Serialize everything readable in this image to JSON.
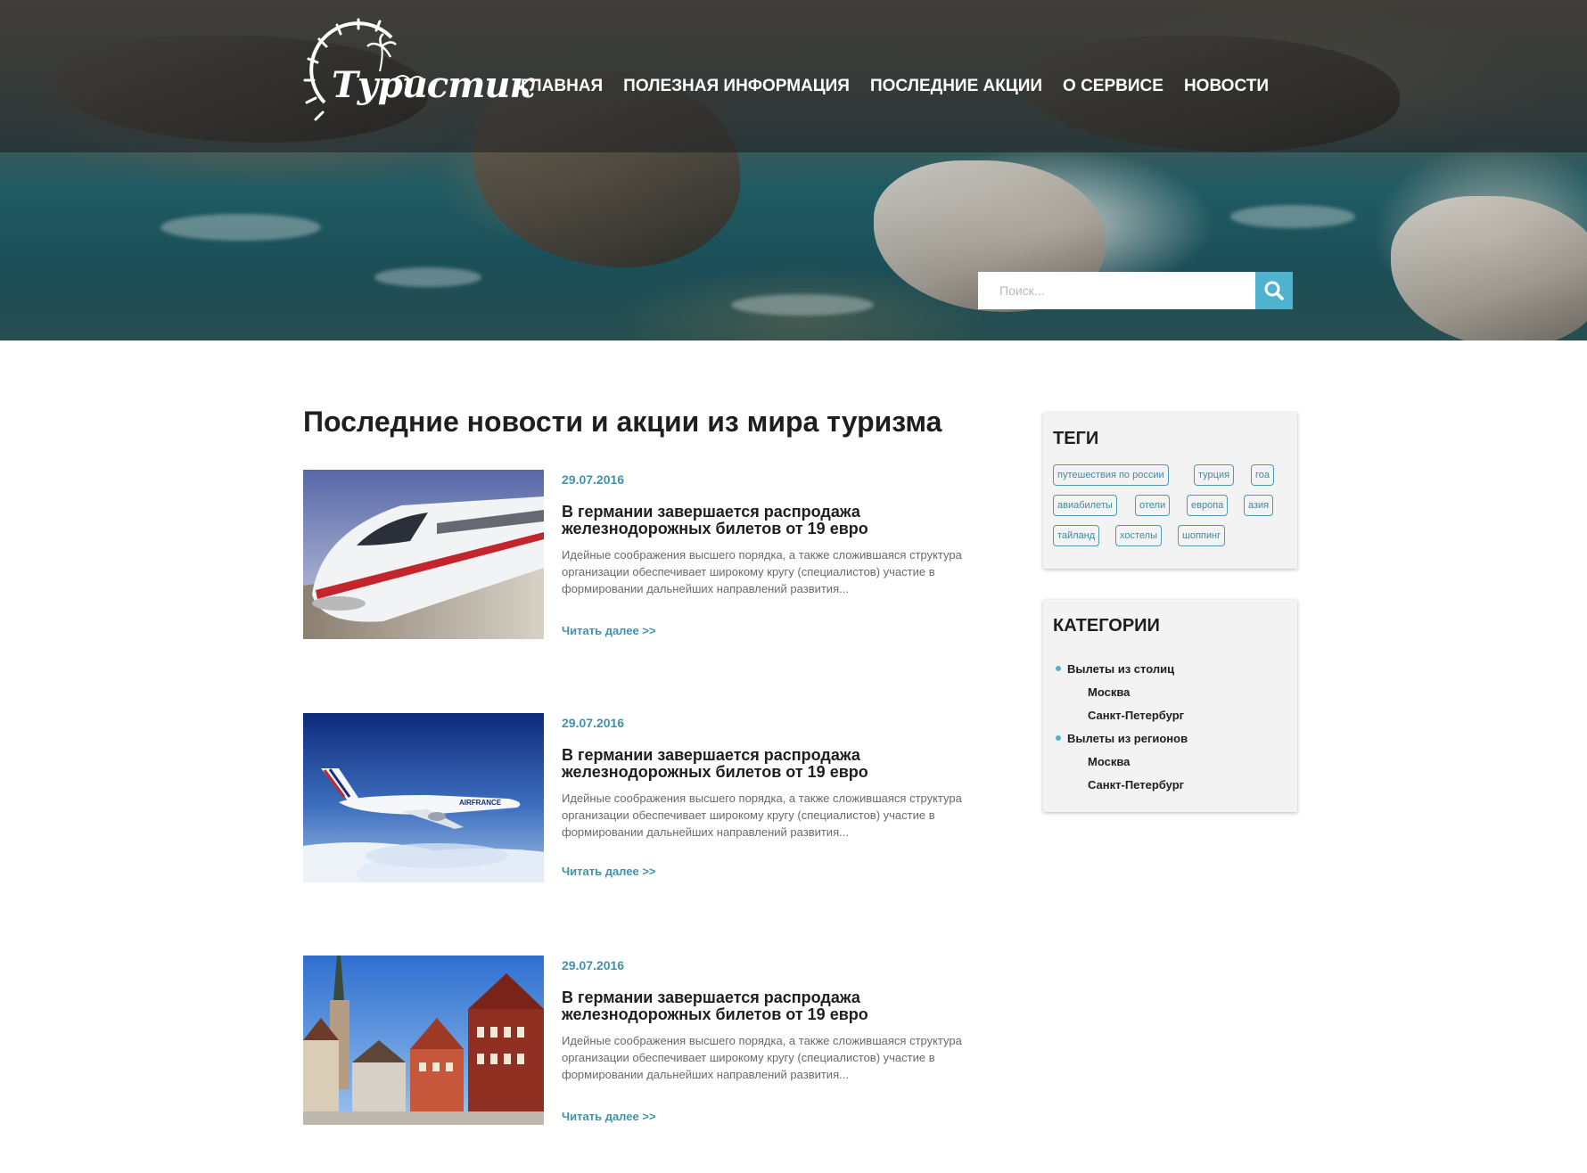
{
  "logo": {
    "text": "Туристик"
  },
  "nav": {
    "items": [
      {
        "label": "ГЛАВНАЯ"
      },
      {
        "label": "ПОЛЕЗНАЯ ИНФОРМАЦИЯ"
      },
      {
        "label": "ПОСЛЕДНИЕ АКЦИИ"
      },
      {
        "label": "О СЕРВИСЕ"
      },
      {
        "label": "НОВОСТИ"
      }
    ]
  },
  "search": {
    "placeholder": "Поиск..."
  },
  "main": {
    "title": "Последние новости и акции из мира туризма",
    "articles": [
      {
        "image": "high-speed-train",
        "date": "29.07.2016",
        "title": "В германии завершается распродажа железнодорожных билетов от 19 евро",
        "excerpt": "Идейные соображения высшего порядка, а также сложившаяся структура организации обеспечивает широкому кругу (специалистов) участие в формировании дальнейших направлений развития...",
        "more": "Читать далее >>"
      },
      {
        "image": "airplane-in-clouds",
        "date": "29.07.2016",
        "title": "В германии завершается распродажа железнодорожных билетов от 19 евро",
        "excerpt": "Идейные соображения высшего порядка, а также сложившаяся структура организации обеспечивает широкому кругу (специалистов) участие в формировании дальнейших направлений развития...",
        "more": "Читать далее >>"
      },
      {
        "image": "old-town-square",
        "date": "29.07.2016",
        "title": "В германии завершается распродажа железнодорожных билетов от 19 евро",
        "excerpt": "Идейные соображения высшего порядка, а также сложившаяся структура организации обеспечивает широкому кругу (специалистов) участие в формировании дальнейших направлений развития...",
        "more": "Читать далее >>"
      }
    ]
  },
  "sidebar": {
    "tags": {
      "title": "ТЕГИ",
      "items": [
        "путешествия по россии",
        "турция",
        "гоа",
        "авиабилеты",
        "отели",
        "европа",
        "азия",
        "тайланд",
        "хостелы",
        "шоппинг"
      ]
    },
    "categories": {
      "title": "КАТЕГОРИИ",
      "groups": [
        {
          "label": "Вылеты из столиц",
          "children": [
            "Москва",
            "Санкт-Петербург"
          ]
        },
        {
          "label": "Вылеты из регионов",
          "children": [
            "Москва",
            "Санкт-Петербург"
          ]
        }
      ]
    }
  },
  "colors": {
    "accent": "#4fb3cf",
    "link": "#3f93a9",
    "widget_bg": "#f2f3f2"
  }
}
